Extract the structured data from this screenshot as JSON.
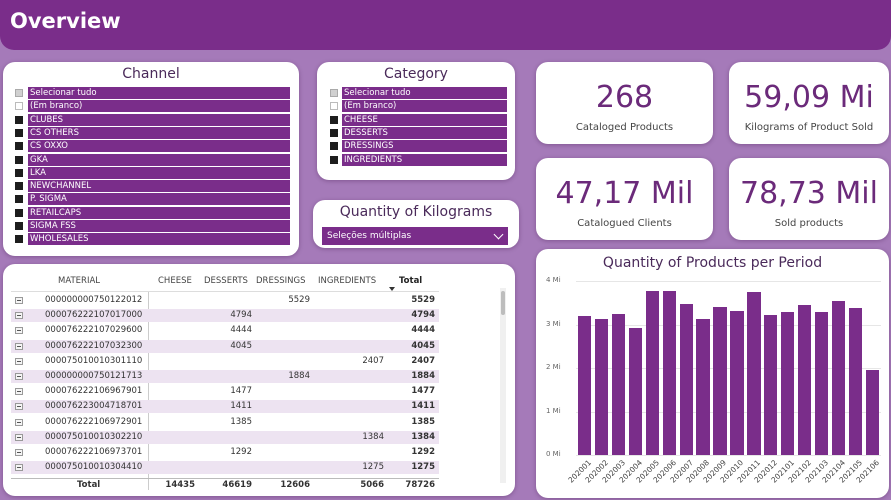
{
  "header": {
    "title": "Overview"
  },
  "channel": {
    "title": "Channel",
    "items": [
      {
        "label": "Selecionar tudo",
        "state": "part"
      },
      {
        "label": "(Em branco)",
        "state": "off"
      },
      {
        "label": "CLUBES",
        "state": "on"
      },
      {
        "label": "CS OTHERS",
        "state": "on"
      },
      {
        "label": "CS OXXO",
        "state": "on"
      },
      {
        "label": "GKA",
        "state": "on"
      },
      {
        "label": "LKA",
        "state": "on"
      },
      {
        "label": "NEWCHANNEL",
        "state": "on"
      },
      {
        "label": "P. SIGMA",
        "state": "on"
      },
      {
        "label": "RETAILCAPS",
        "state": "on"
      },
      {
        "label": "SIGMA FSS",
        "state": "on"
      },
      {
        "label": "WHOLESALES",
        "state": "on"
      }
    ]
  },
  "category": {
    "title": "Category",
    "items": [
      {
        "label": "Selecionar tudo",
        "state": "part"
      },
      {
        "label": "(Em branco)",
        "state": "off"
      },
      {
        "label": "CHEESE",
        "state": "on"
      },
      {
        "label": "DESSERTS",
        "state": "on"
      },
      {
        "label": "DRESSINGS",
        "state": "on"
      },
      {
        "label": "INGREDIENTS",
        "state": "on"
      }
    ]
  },
  "kilograms": {
    "title": "Quantity of Kilograms",
    "selected": "Seleções múltiplas"
  },
  "kpis": {
    "catalogued_products": {
      "value": "268",
      "label": "Cataloged Products"
    },
    "kg_sold": {
      "value": "59,09 Mi",
      "label": "Kilograms of Product Sold"
    },
    "clients": {
      "value": "47,17 Mil",
      "label": "Catalogued Clients"
    },
    "sold_products": {
      "value": "78,73 Mil",
      "label": "Sold products"
    }
  },
  "table": {
    "headers": [
      "MATERIAL",
      "CHEESE",
      "DESSERTS",
      "DRESSINGS",
      "INGREDIENTS",
      "Total"
    ],
    "rows": [
      [
        "000000000750122012",
        "",
        "",
        "5529",
        "",
        "5529"
      ],
      [
        "000076222107017000",
        "",
        "4794",
        "",
        "",
        "4794"
      ],
      [
        "000076222107029600",
        "",
        "4444",
        "",
        "",
        "4444"
      ],
      [
        "000076222107032300",
        "",
        "4045",
        "",
        "",
        "4045"
      ],
      [
        "000075010010301110",
        "",
        "",
        "",
        "2407",
        "2407"
      ],
      [
        "000000000750121713",
        "",
        "",
        "1884",
        "",
        "1884"
      ],
      [
        "000076222106967901",
        "",
        "1477",
        "",
        "",
        "1477"
      ],
      [
        "000076223004718701",
        "",
        "1411",
        "",
        "",
        "1411"
      ],
      [
        "000076222106972901",
        "",
        "1385",
        "",
        "",
        "1385"
      ],
      [
        "000075010010302210",
        "",
        "",
        "",
        "1384",
        "1384"
      ],
      [
        "000076222106973701",
        "",
        "1292",
        "",
        "",
        "1292"
      ],
      [
        "000075010010304410",
        "",
        "",
        "",
        "1275",
        "1275"
      ]
    ],
    "total": [
      "Total",
      "14435",
      "46619",
      "12606",
      "5066",
      "78726"
    ]
  },
  "chart_data": {
    "type": "bar",
    "title": "Quantity of Products per Period",
    "categories": [
      "202001",
      "202002",
      "202003",
      "202004",
      "202005",
      "202006",
      "202007",
      "202008",
      "202009",
      "202010",
      "202011",
      "202012",
      "202101",
      "202102",
      "202103",
      "202104",
      "202105",
      "202106"
    ],
    "values": [
      3.2,
      3.12,
      3.25,
      2.92,
      3.78,
      3.78,
      3.48,
      3.12,
      3.4,
      3.3,
      3.75,
      3.22,
      3.28,
      3.45,
      3.28,
      3.55,
      3.38,
      1.95
    ],
    "ylim": [
      0,
      4
    ],
    "yticks": [
      "0 Mi",
      "1 Mi",
      "2 Mi",
      "3 Mi",
      "4 Mi"
    ],
    "bar_color": "#7a2d8a",
    "grid": true
  },
  "colors": {
    "accent": "#7a2d8a",
    "background": "#a57ab9"
  }
}
